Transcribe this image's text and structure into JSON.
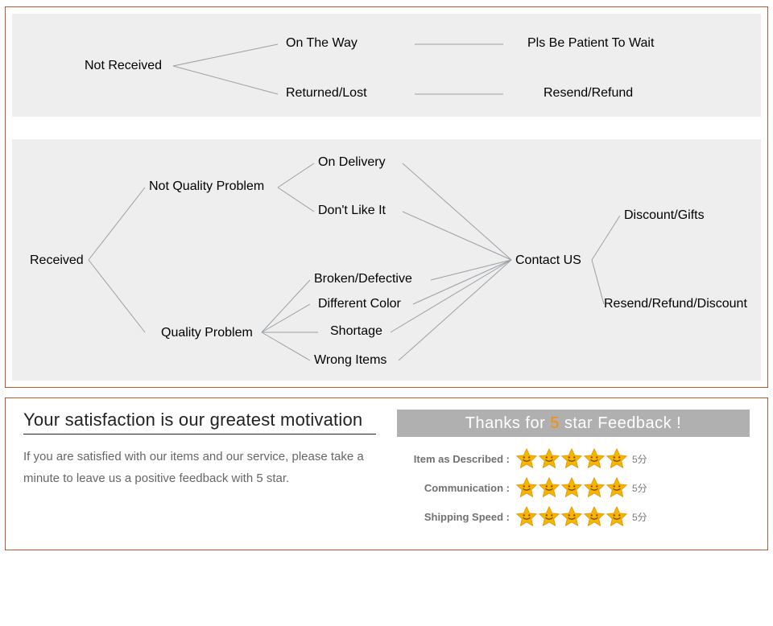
{
  "flow1": {
    "root": "Not Received",
    "b1": "On The Way",
    "b2": "Returned/Lost",
    "o1": "Pls Be Patient To Wait",
    "o2": "Resend/Refund"
  },
  "flow2": {
    "root": "Received",
    "nq": "Not Quality Problem",
    "q": "Quality Problem",
    "nq_sub1": "On Delivery",
    "nq_sub2": "Don't Like It",
    "q_sub1": "Broken/Defective",
    "q_sub2": "Different Color",
    "q_sub3": "Shortage",
    "q_sub4": "Wrong Items",
    "contact": "Contact US",
    "out1": "Discount/Gifts",
    "out2": "Resend/Refund/Discount"
  },
  "feedback": {
    "title": "Your satisfaction is our greatest motivation",
    "body": "If you are satisfied with our items and our service, please take a minute to leave us a positive feedback with 5 star.",
    "thanks_pre": "Thanks for",
    "thanks_accent": "5",
    "thanks_post": "star Feedback !",
    "rows": [
      {
        "label": "Item as Described :",
        "score": "5分"
      },
      {
        "label": "Communication :",
        "score": "5分"
      },
      {
        "label": "Shipping Speed :",
        "score": "5分"
      }
    ]
  }
}
